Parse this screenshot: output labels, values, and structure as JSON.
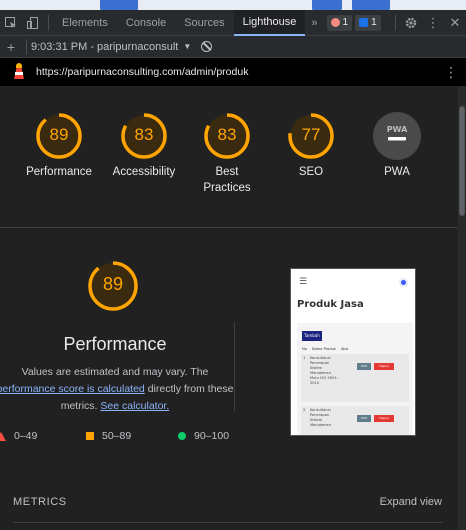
{
  "devtools": {
    "tabs": [
      "Elements",
      "Console",
      "Sources",
      "Lighthouse"
    ],
    "active_tab": "Lighthouse",
    "more": "»",
    "error_count": "1",
    "message_count": "1"
  },
  "toolbar": {
    "report_selector": "9:03:31 PM - paripurnaconsult"
  },
  "url": "https://paripurnaconsulting.com/admin/produk",
  "categories": [
    {
      "label": "Performance",
      "score": "89",
      "value": 89
    },
    {
      "label": "Accessibility",
      "score": "83",
      "value": 83
    },
    {
      "label": "Best Practices",
      "score": "83",
      "value": 83
    },
    {
      "label": "SEO",
      "score": "77",
      "value": 77
    },
    {
      "label": "PWA",
      "score": "PWA",
      "value": null
    }
  ],
  "performance": {
    "score": "89",
    "value": 89,
    "title": "Performance",
    "desc_prefix": "Values are estimated and may vary. The",
    "desc_link": "performance score is calculated",
    "desc_middle": "directly from these metrics.",
    "calc_link": "See calculator."
  },
  "legend": {
    "fail": "0–49",
    "average": "50–89",
    "pass": "90–100"
  },
  "screenshot": {
    "heading": "Produk Jasa",
    "add_button": "Tambah",
    "headers": [
      "No",
      "Nama Produk",
      "Aksi"
    ],
    "rows": [
      {
        "no": "1",
        "name": "Konsultansi Penerapan Sistem Manajemen Mutu ISO 9001: 2015",
        "edit": "Edit",
        "delete": "Hapus"
      },
      {
        "no": "2",
        "name": "Konsultansi Penerapan Sistem Manajemen",
        "edit": "Edit",
        "delete": "Hapus"
      }
    ]
  },
  "metrics": {
    "label": "METRICS",
    "expand": "Expand view"
  },
  "colors": {
    "average": "#ffa400",
    "fail": "#ff4e42",
    "pass": "#0cce6b",
    "link": "#8ab4f8"
  }
}
